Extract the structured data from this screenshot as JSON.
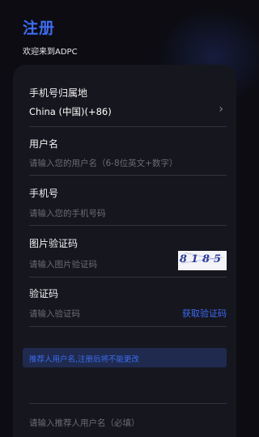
{
  "header": {
    "title": "注册",
    "subtitle": "欢迎来到ADPC"
  },
  "form": {
    "region": {
      "label": "手机号归属地",
      "value": "China (中国)(+86)",
      "chevron": "›"
    },
    "username": {
      "label": "用户名",
      "placeholder": "请输入您的用户名（6-8位英文+数字）"
    },
    "phone": {
      "label": "手机号",
      "placeholder": "请输入您的手机号码"
    },
    "image_captcha": {
      "label": "图片验证码",
      "placeholder": "请输入图片验证码",
      "captcha_text": "8185"
    },
    "sms_code": {
      "label": "验证码",
      "placeholder": "请输入验证码",
      "send_label": "获取验证码"
    },
    "notice": "推荐人用户名,注册后将不能更改",
    "referrer": {
      "placeholder": "请输入推荐人用户名（必填）"
    }
  },
  "colors": {
    "accent": "#3d6cf2",
    "background": "#0c0c12",
    "card": "#16161e",
    "notice_bg": "#1f2a4e"
  }
}
